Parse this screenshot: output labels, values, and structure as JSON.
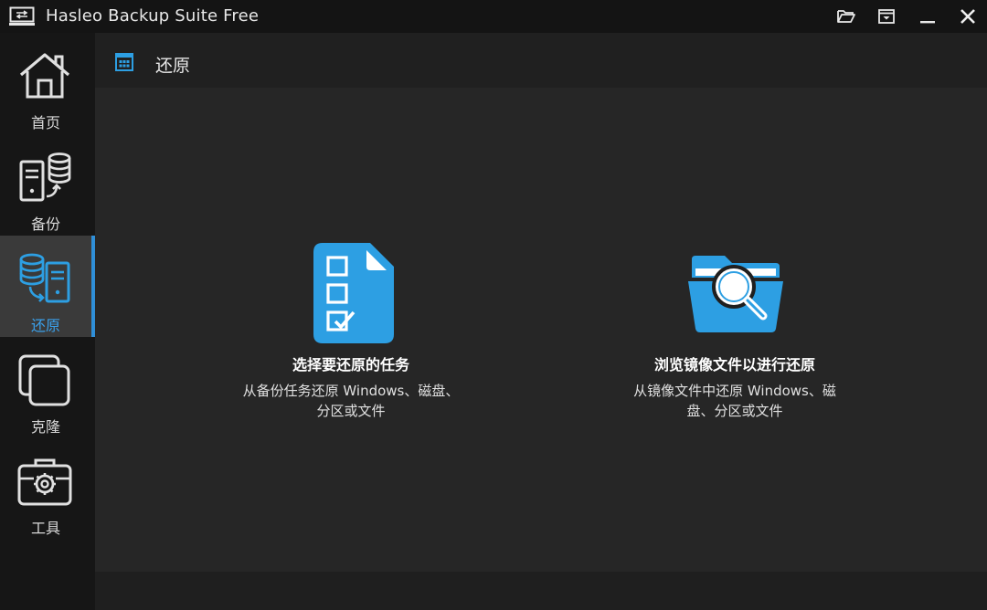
{
  "window": {
    "title": "Hasleo Backup Suite Free"
  },
  "titlebar_buttons": [
    {
      "icon": "folder-open-icon"
    },
    {
      "icon": "menu-dropdown-icon"
    },
    {
      "icon": "minimize-icon"
    },
    {
      "icon": "close-icon"
    }
  ],
  "sidebar": {
    "items": [
      {
        "label": "首页",
        "icon": "home-icon",
        "active": false
      },
      {
        "label": "备份",
        "icon": "backup-icon",
        "active": false
      },
      {
        "label": "还原",
        "icon": "restore-icon",
        "active": true
      },
      {
        "label": "克隆",
        "icon": "clone-icon",
        "active": false
      },
      {
        "label": "工具",
        "icon": "toolbox-icon",
        "active": false
      }
    ]
  },
  "header": {
    "title": "还原",
    "icon": "grid-icon"
  },
  "options": [
    {
      "title": "选择要还原的任务",
      "desc_line1": "从备份任务还原 Windows、磁盘、",
      "desc_line2": "分区或文件",
      "icon": "task-checklist-icon"
    },
    {
      "title": "浏览镜像文件以进行还原",
      "desc_line1": "从镜像文件中还原 Windows、磁",
      "desc_line2": "盘、分区或文件",
      "icon": "folder-search-icon"
    }
  ],
  "colors": {
    "accent": "#2f8fd8",
    "icon_blue": "#2d9fe3",
    "active_label": "#3aa0ea"
  }
}
